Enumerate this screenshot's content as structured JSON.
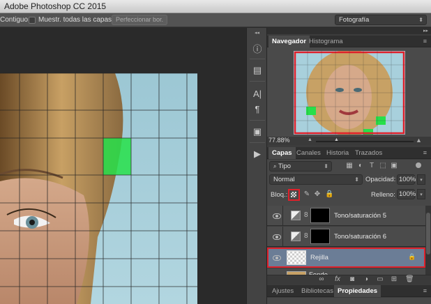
{
  "window": {
    "title": "Adobe Photoshop CC 2015"
  },
  "options_bar": {
    "contiguous_label": "Contiguo",
    "sample_all_layers_label": "Muestr. todas las capas",
    "refine_edge_label": "Perfeccionar bor.",
    "workspace_value": "Fotografía"
  },
  "navigator": {
    "tabs": [
      "Navegador",
      "Histograma"
    ],
    "zoom": "77.88%"
  },
  "layers_panel": {
    "tabs": [
      "Capas",
      "Canales",
      "Historia",
      "Trazados"
    ],
    "filter_value": "Tipo",
    "blend_mode": "Normal",
    "opacity_label": "Opacidad:",
    "opacity_value": "100%",
    "lock_label": "Bloq.:",
    "fill_label": "Relleno:",
    "fill_value": "100%",
    "layers": [
      {
        "name": "Tono/saturación 5",
        "selected": false
      },
      {
        "name": "Tono/saturación 6",
        "selected": false
      },
      {
        "name": "Rejilla",
        "selected": true
      },
      {
        "name": "Fondo",
        "selected": false
      }
    ]
  },
  "bottom_tabs": [
    "Ajustes",
    "Bibliotecas",
    "Propiedades"
  ],
  "colors": {
    "highlight": "#e0202a",
    "selected_layer": "#6b7d96",
    "grid_green": "#27e04a"
  }
}
